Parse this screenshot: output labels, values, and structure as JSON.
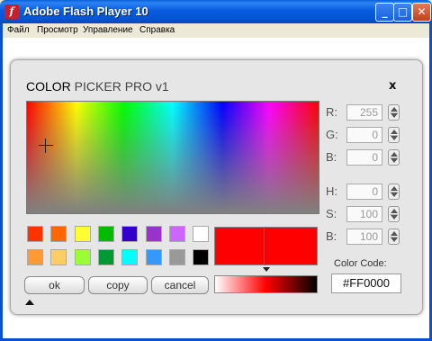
{
  "window": {
    "title": "Adobe Flash Player 10",
    "icon": "flash-player-icon",
    "icon_glyph": "f",
    "controls": {
      "minimize": "_",
      "maximize": "□",
      "close": "✕"
    }
  },
  "menu": {
    "items": [
      "Файл",
      "Просмотр",
      "Управление",
      "Справка"
    ]
  },
  "picker": {
    "title_bold": "COLOR",
    "title_rest": " PICKER PRO v1",
    "close_label": "x",
    "channels": {
      "r": {
        "label": "R:",
        "value": "255"
      },
      "g": {
        "label": "G:",
        "value": "0"
      },
      "b": {
        "label": "B:",
        "value": "0"
      },
      "h": {
        "label": "H:",
        "value": "0"
      },
      "s": {
        "label": "S:",
        "value": "100"
      },
      "v": {
        "label": "B:",
        "value": "100"
      }
    },
    "swatches_row1": [
      "#ff3300",
      "#ff6600",
      "#ffff33",
      "#00bb00",
      "#3300cc",
      "#9933cc",
      "#cc66ff",
      "#ffffff"
    ],
    "swatches_row2": [
      "#ff9933",
      "#ffcc66",
      "#99ff33",
      "#009933",
      "#00ffff",
      "#3399ff",
      "#999999",
      "#000000"
    ],
    "current_color": "#ff0000",
    "buttons": {
      "ok": "ok",
      "copy": "copy",
      "cancel": "cancel"
    },
    "color_code_label": "Color Code:",
    "color_code_value": "#FF0000"
  }
}
